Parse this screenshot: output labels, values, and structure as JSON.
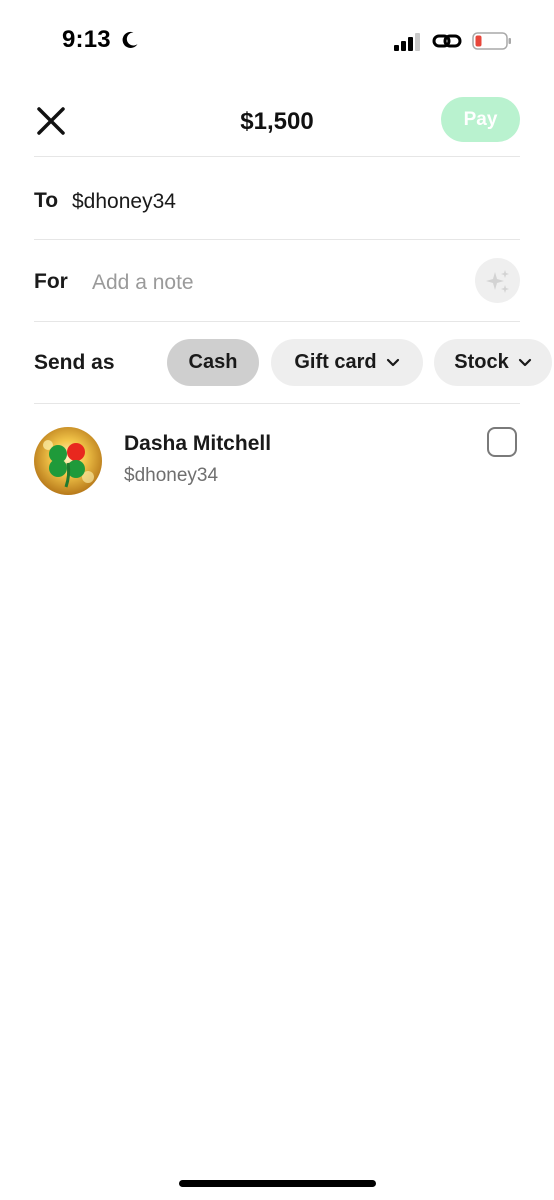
{
  "status_bar": {
    "time": "9:13",
    "icons": [
      "moon-icon",
      "signal-icon",
      "link-icon",
      "battery-icon"
    ],
    "battery_color": "#e8463a"
  },
  "header": {
    "close_icon": "close-icon",
    "amount": "$1,500",
    "pay_label": "Pay",
    "pay_color": "#b9f2cf"
  },
  "to_row": {
    "label": "To",
    "value": "$dhoney34"
  },
  "for_row": {
    "label": "For",
    "placeholder": "Add a note",
    "value": "",
    "icon": "sparkle-icon"
  },
  "send_as": {
    "label": "Send as",
    "options": [
      {
        "label": "Cash",
        "selected": true
      },
      {
        "label": "Gift card",
        "selected": false,
        "has_dropdown": true
      },
      {
        "label": "Stock",
        "selected": false,
        "has_dropdown": true
      }
    ]
  },
  "recipients": [
    {
      "name": "Dasha Mitchell",
      "handle": "$dhoney34",
      "avatar_icon": "four-leaf-clover-avatar",
      "checked": false
    }
  ]
}
